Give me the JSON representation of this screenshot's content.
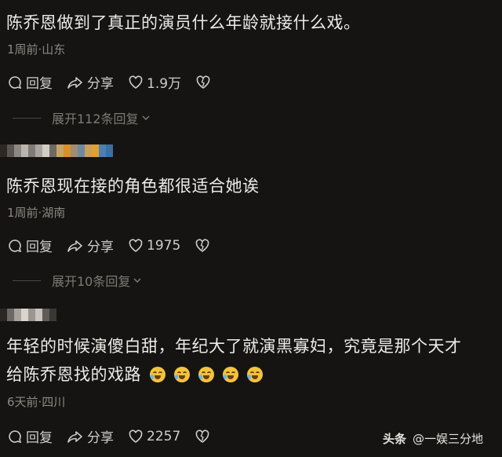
{
  "comments": [
    {
      "text": "陈乔恩做到了真正的演员什么年龄就接什么戏。",
      "meta": "1周前·山东",
      "reply": "回复",
      "share": "分享",
      "likes": "1.9万",
      "expand": "展开112条回复"
    },
    {
      "text": "陈乔恩现在接的角色都很适合她诶",
      "meta": "1周前·湖南",
      "reply": "回复",
      "share": "分享",
      "likes": "1975",
      "expand": "展开10条回复"
    },
    {
      "text_line1": "年轻的时候演傻白甜，年纪大了就演黑寡妇，究竟是那个天才",
      "text_line2": "给陈乔恩找的戏路",
      "meta": "6天前·四川",
      "reply": "回复",
      "share": "分享",
      "likes": "2257"
    }
  ],
  "watermark": {
    "brand": "头条",
    "account": "@一娱三分地"
  },
  "colors": {
    "background": "#161412",
    "text": "#ecebe8",
    "meta": "#8b8883",
    "emoji": "#f3c43b"
  },
  "icons": [
    "comment-icon",
    "share-icon",
    "heart-icon",
    "dislike-heart-icon",
    "chevron-down-icon",
    "crying-laughing-emoji"
  ]
}
